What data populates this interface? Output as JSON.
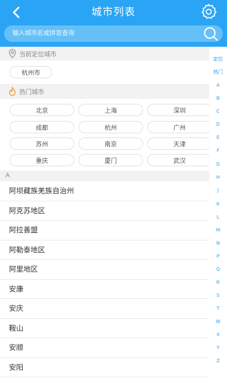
{
  "header": {
    "title": "城市列表",
    "back_icon": "chevron-left-icon",
    "settings_icon": "gear-icon",
    "background": "#2aa4f4"
  },
  "search": {
    "placeholder": "输入城市名或拼音查询",
    "icon": "search-icon"
  },
  "location": {
    "label": "当前定位城市",
    "icon": "location-pin-icon",
    "city": "杭州市"
  },
  "hot": {
    "label": "热门城市",
    "icon": "flame-icon",
    "cities": [
      "北京",
      "上海",
      "深圳",
      "成都",
      "杭州",
      "广州",
      "苏州",
      "南京",
      "天津",
      "重庆",
      "厦门",
      "武汉"
    ]
  },
  "list": {
    "letter": "A",
    "cities": [
      "阿坝藏族羌族自治州",
      "阿克苏地区",
      "阿拉善盟",
      "阿勒泰地区",
      "阿里地区",
      "安康",
      "安庆",
      "鞍山",
      "安顺",
      "安阳"
    ]
  },
  "index": [
    "定位",
    "热门",
    "A",
    "B",
    "C",
    "D",
    "E",
    "F",
    "G",
    "H",
    "J",
    "K",
    "L",
    "M",
    "N",
    "P",
    "Q",
    "R",
    "S",
    "T",
    "W",
    "X",
    "Y",
    "Z"
  ],
  "colors": {
    "accent": "#2aa4f4",
    "section_bg": "#f2f2f2"
  }
}
